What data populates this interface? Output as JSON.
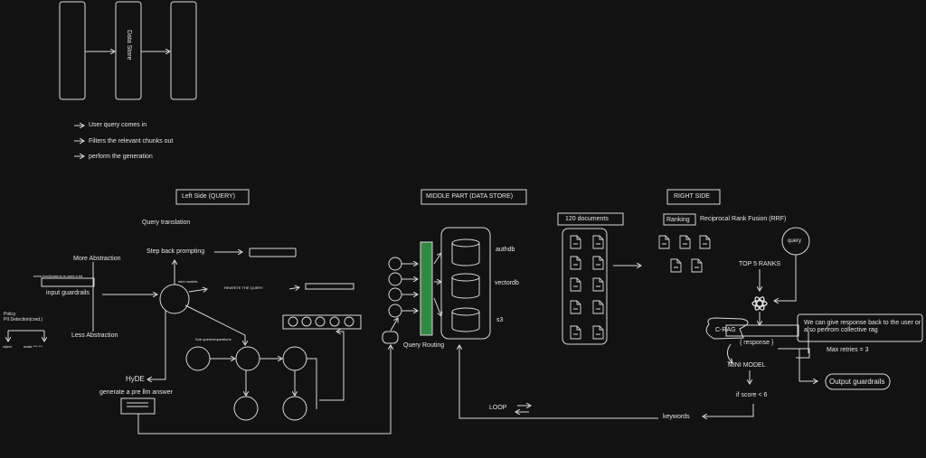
{
  "top": {
    "data_store_label": "Data Store",
    "steps": [
      "User query comes in",
      "Filters the relevant chunks out",
      "perform the generation"
    ]
  },
  "left": {
    "section_label": "Left Side (QUERY)",
    "query_translation": "Query translation",
    "step_back": "Step back prompting",
    "more_abstraction": "More Abstraction",
    "less_abstraction": "Less Abstraction",
    "meta_tool": "meta (tool)/claims is used a lot",
    "input_guardrails": "input guardrails",
    "mini_models": "mini models",
    "rewrite_query": "REWRITE THE QUERY",
    "sub_queries": "Sub queries/questions",
    "policy": "Policy",
    "pii": "PII Detection(cred.)",
    "reject": "reject",
    "mask": "mask",
    "mask_suffix": "***.***",
    "hyde": "HyDE",
    "generate": "generate a pre llm answer"
  },
  "middle": {
    "section_label": "MIDDLE PART (DATA STORE)",
    "db_labels": [
      "authdb",
      "vectordb",
      "s3"
    ],
    "query_routing": "Query Routing",
    "loop": "LOOP"
  },
  "right": {
    "section_label": "RIGHT SIDE",
    "documents": "120 documents",
    "ranking": "Ranking",
    "rrf": "Reciprocal Rank Fusion (RRF)",
    "query": "query",
    "top5": "TOP 5 RANKS",
    "crag": "C-RAG",
    "response": "{ response }",
    "note": "We can give response back to the user or also perfrom collective rag",
    "max_retries": "Max retries = 3",
    "mini_model": "MINI MODEL",
    "if_score": "if score < 6",
    "keywords": "keywords",
    "output_guardrails": "Output guardrails"
  }
}
